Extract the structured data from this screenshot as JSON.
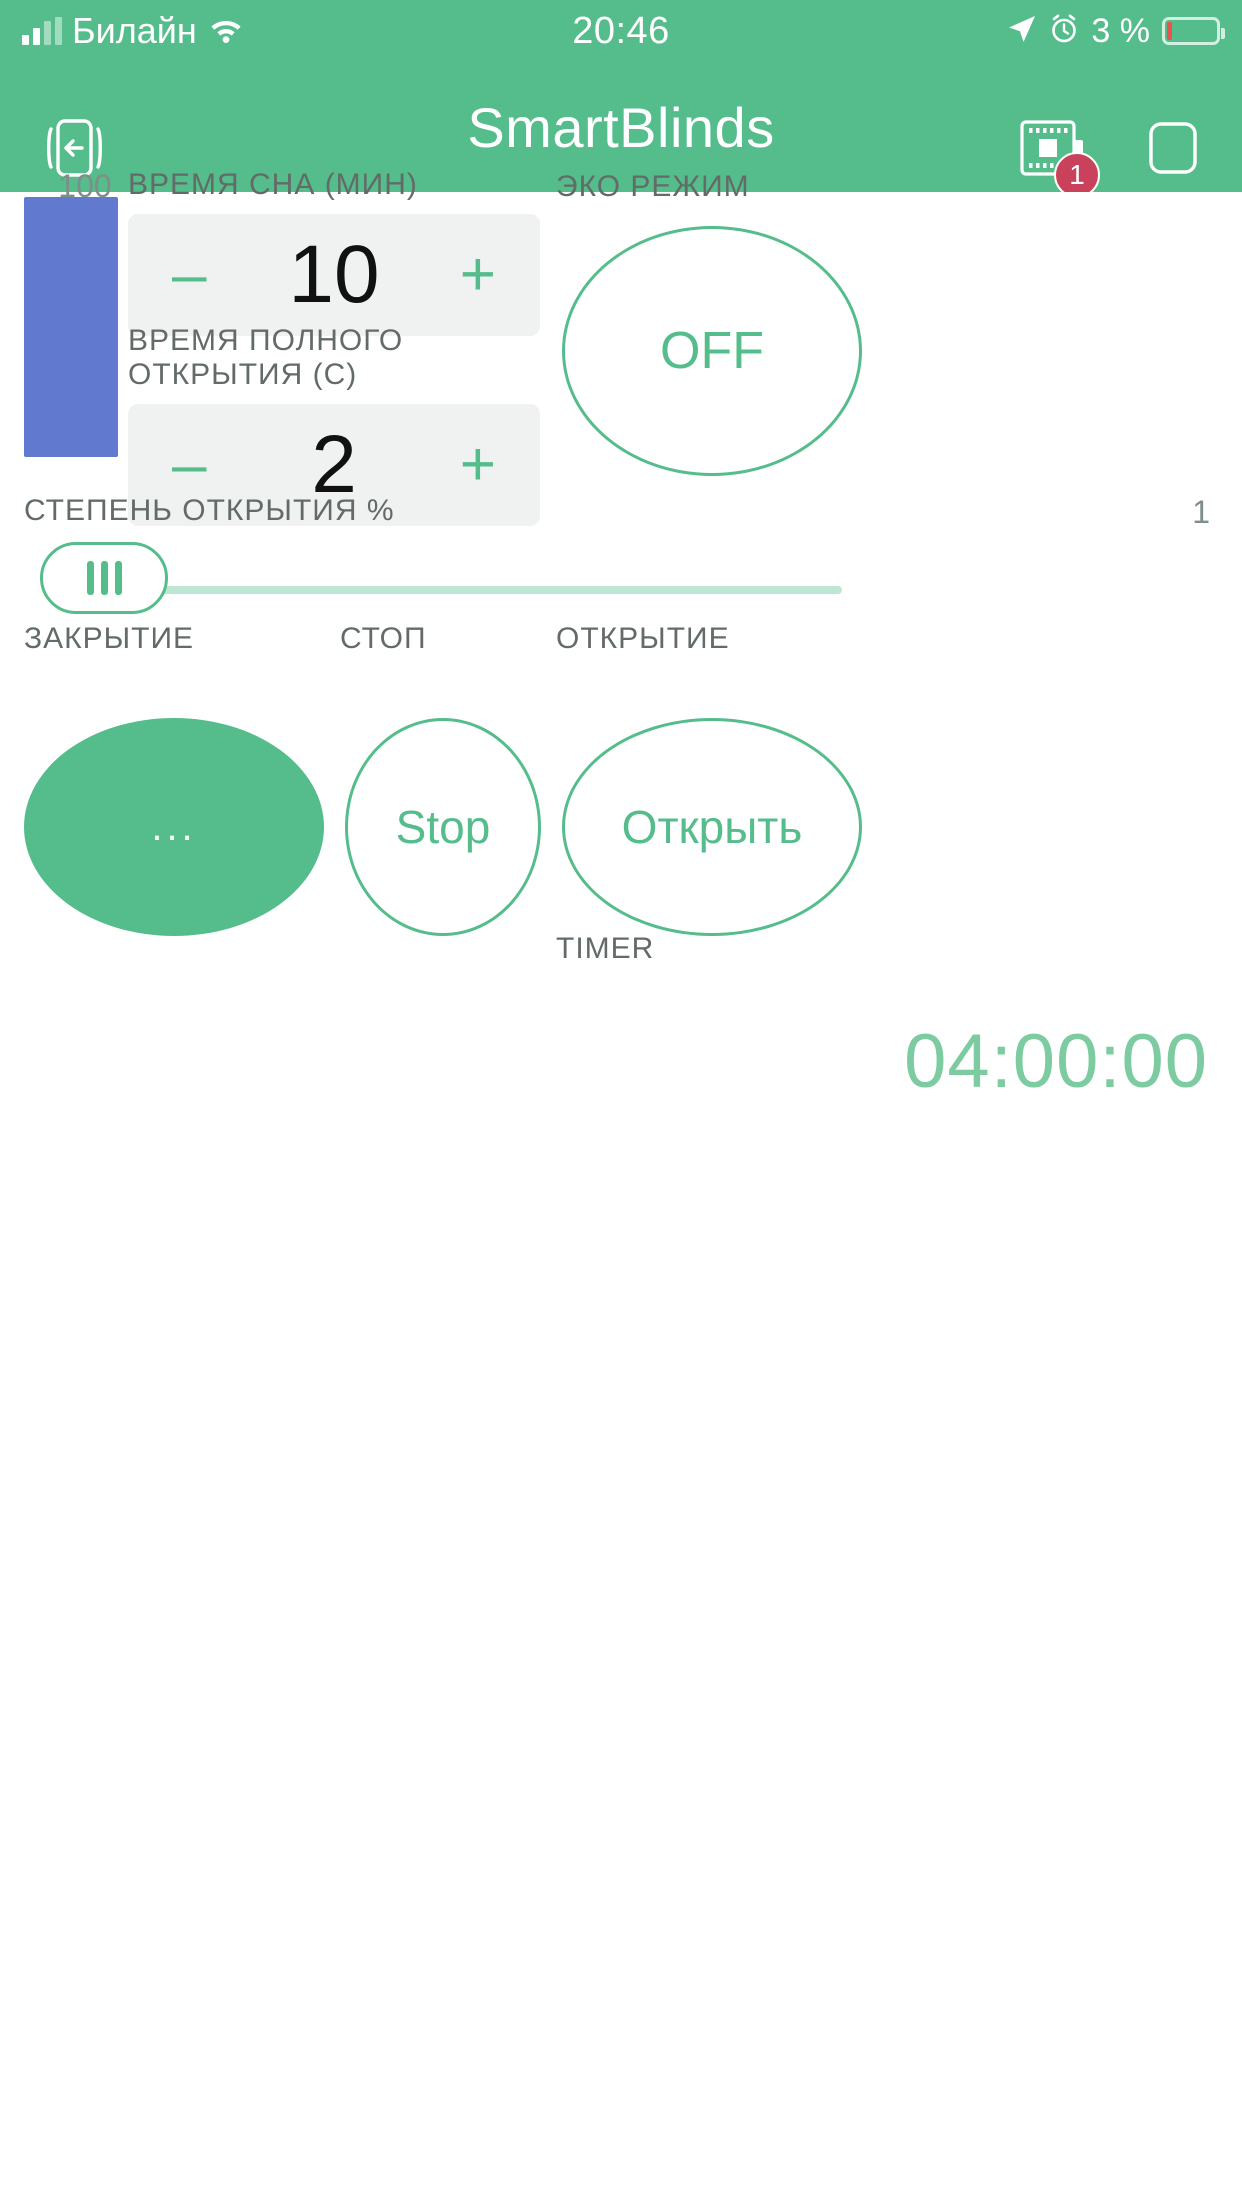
{
  "status_bar": {
    "carrier": "Билайн",
    "signal_icon": "signal-bars-icon",
    "wifi_icon": "wifi-icon",
    "time": "20:46",
    "location_icon": "location-arrow-icon",
    "alarm_icon": "alarm-clock-icon",
    "battery_percent": "3 %",
    "battery_icon": "battery-icon"
  },
  "navbar": {
    "back_icon": "back-exit-icon",
    "title": "SmartBlinds",
    "board_icon": "circuit-board-icon",
    "board_badge": "1",
    "square_icon": "rounded-square-icon"
  },
  "level_bar": {
    "label": "100",
    "color": "#6279d0",
    "value": 100
  },
  "sleep_time": {
    "label": "ВРЕМЯ СНА (МИН)",
    "value": "10",
    "minus": "–",
    "plus": "+"
  },
  "full_open_time": {
    "label": "ВРЕМЯ ПОЛНОГО ОТКРЫТИЯ (С)",
    "value": "2",
    "minus": "–",
    "plus": "+"
  },
  "eco_mode": {
    "label": "ЭКО РЕЖИМ",
    "button_text": "OFF"
  },
  "open_degree": {
    "label": "СТЕПЕНЬ ОТКРЫТИЯ %",
    "value": "1",
    "thumb_icon": "drag-handle-icon"
  },
  "controls": {
    "close": {
      "label": "ЗАКРЫТИЕ",
      "button_text": "..."
    },
    "stop": {
      "label": "СТОП",
      "button_text": "Stop"
    },
    "open": {
      "label": "ОТКРЫТИЕ",
      "button_text": "Открыть"
    }
  },
  "timer": {
    "label": "TIMER",
    "value": "04:00:00"
  },
  "colors": {
    "accent": "#55bd8c",
    "accent_light": "#7ccba1",
    "badge": "#c9415a",
    "bar_blue": "#6279d0",
    "field_bg": "#f0f1f1"
  }
}
